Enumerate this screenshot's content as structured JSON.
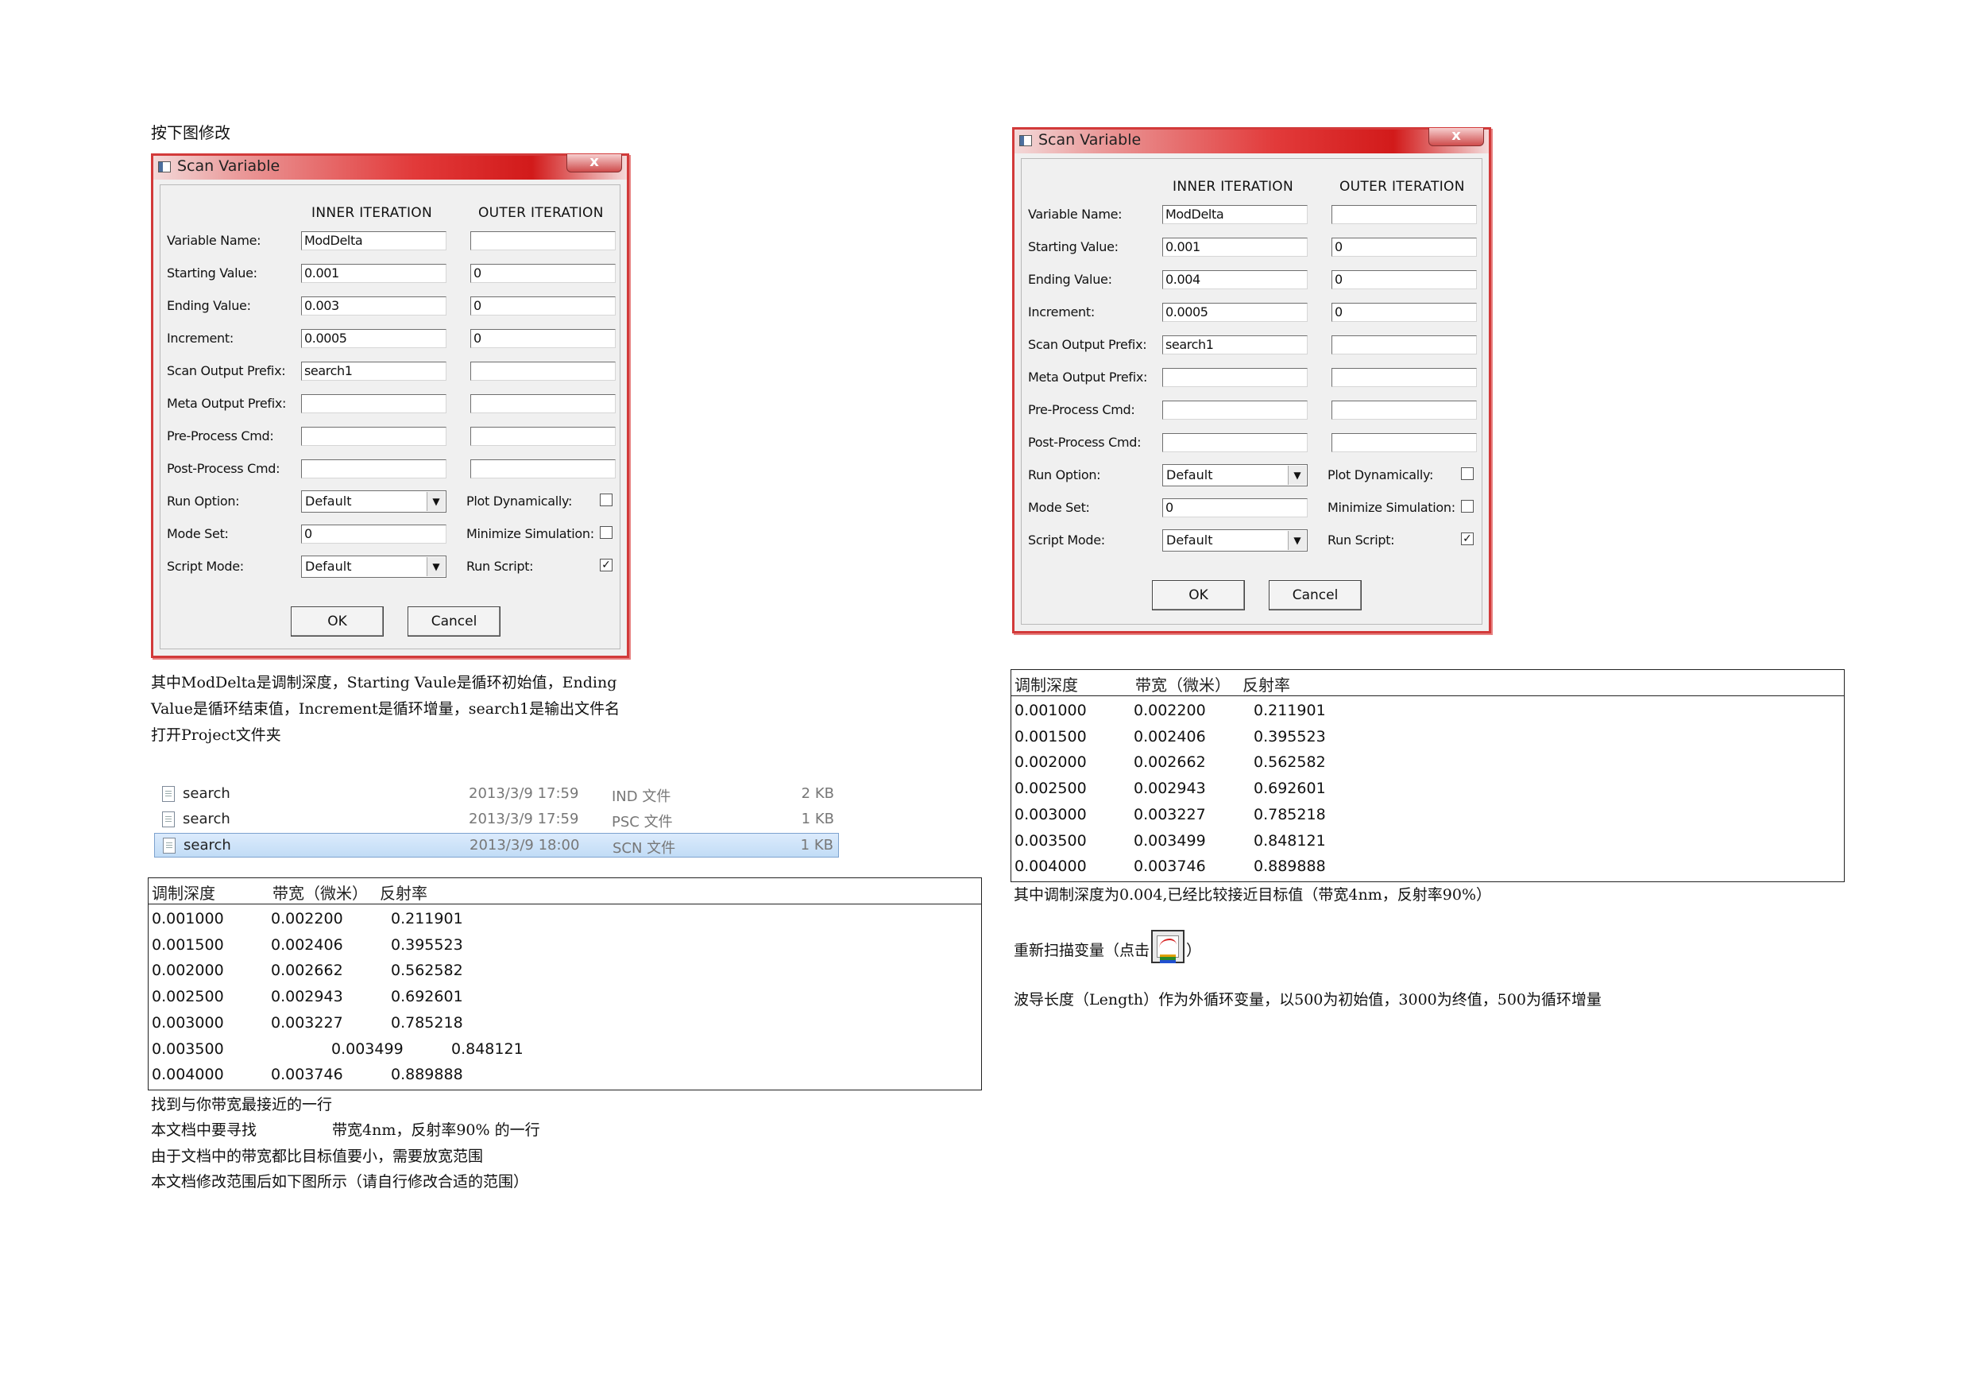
{
  "captions": {
    "intro": "按下图修改",
    "explain_line1": "其中ModDelta是调制深度，Starting Vaule是循环初始值，Ending",
    "explain_line2": "Value是循环结束值，Increment是循环增量，search1是输出文件名",
    "open_project": "打开Project文件夹",
    "find_row": "找到与你带宽最接近的一行",
    "target_label": "本文档中要寻找",
    "target_value": "带宽4nm，反射率90% 的一行",
    "widen_range": "由于文档中的带宽都比目标值要小，需要放宽范围",
    "modified_range": "本文档修改范围后如下图所示（请自行修改合适的范围）",
    "closest": "其中调制深度为0.004,已经比较接近目标值（带宽4nm，反射率90%）",
    "rescan_prefix": "重新扫描变量（点击",
    "rescan_suffix": "）",
    "length_note": "波导长度（Length）作为外循环变量，以500为初始值，3000为终值，500为循环增量"
  },
  "dialog_labels": {
    "title": "Scan Variable",
    "close": "x",
    "inner_header": "INNER ITERATION",
    "outer_header": "OUTER ITERATION",
    "variable_name": "Variable Name:",
    "starting_value": "Starting Value:",
    "ending_value": "Ending Value:",
    "increment": "Increment:",
    "scan_output_prefix": "Scan Output Prefix:",
    "meta_output_prefix": "Meta Output Prefix:",
    "pre_process_cmd": "Pre-Process Cmd:",
    "post_process_cmd": "Post-Process Cmd:",
    "run_option": "Run Option:",
    "mode_set": "Mode Set:",
    "script_mode": "Script Mode:",
    "plot_dynamically": "Plot Dynamically:",
    "minimize_simulation": "Minimize Simulation:",
    "run_script": "Run Script:",
    "ok": "OK",
    "cancel": "Cancel",
    "arrow": "▼",
    "check": "✓"
  },
  "dialog1": {
    "inner": {
      "variable_name": "ModDelta",
      "starting_value": "0.001",
      "ending_value": "0.003",
      "increment": "0.0005",
      "scan_output_prefix": "search1",
      "meta_output_prefix": "",
      "pre_process_cmd": "",
      "post_process_cmd": ""
    },
    "outer": {
      "variable_name": "",
      "starting_value": "0",
      "ending_value": "0",
      "increment": "0",
      "scan_output_prefix": "",
      "meta_output_prefix": "",
      "pre_process_cmd": "",
      "post_process_cmd": ""
    },
    "run_option": "Default",
    "mode_set": "0",
    "script_mode": "Default",
    "plot_dynamically": false,
    "minimize_simulation": false,
    "run_script": true
  },
  "dialog2": {
    "inner": {
      "variable_name": "ModDelta",
      "starting_value": "0.001",
      "ending_value": "0.004",
      "increment": "0.0005",
      "scan_output_prefix": "search1",
      "meta_output_prefix": "",
      "pre_process_cmd": "",
      "post_process_cmd": ""
    },
    "outer": {
      "variable_name": "",
      "starting_value": "0",
      "ending_value": "0",
      "increment": "0",
      "scan_output_prefix": "",
      "meta_output_prefix": "",
      "pre_process_cmd": "",
      "post_process_cmd": ""
    },
    "run_option": "Default",
    "mode_set": "0",
    "script_mode": "Default",
    "plot_dynamically": false,
    "minimize_simulation": false,
    "run_script": true
  },
  "files": [
    {
      "name": "search",
      "date": "2013/3/9 17:59",
      "type": "IND 文件",
      "size": "2 KB",
      "selected": false
    },
    {
      "name": "search",
      "date": "2013/3/9 17:59",
      "type": "PSC 文件",
      "size": "1 KB",
      "selected": false
    },
    {
      "name": "search",
      "date": "2013/3/9 18:00",
      "type": "SCN 文件",
      "size": "1 KB",
      "selected": true
    }
  ],
  "results_table": {
    "headers": [
      "调制深度",
      "带宽（微米）",
      "反射率"
    ],
    "rows": [
      [
        "0.001000",
        "0.002200",
        "0.211901"
      ],
      [
        "0.001500",
        "0.002406",
        "0.395523"
      ],
      [
        "0.002000",
        "0.002662",
        "0.562582"
      ],
      [
        "0.002500",
        "0.002943",
        "0.692601"
      ],
      [
        "0.003000",
        "0.003227",
        "0.785218"
      ],
      [
        "0.003500",
        "0.003499",
        "0.848121"
      ],
      [
        "0.004000",
        "0.003746",
        "0.889888"
      ]
    ]
  }
}
